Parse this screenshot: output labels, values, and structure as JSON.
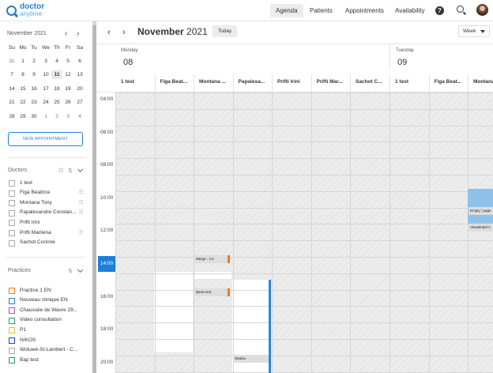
{
  "brand": {
    "line1": "doctor",
    "line2": "anytime"
  },
  "nav": {
    "agenda": "Agenda",
    "patients": "Patients",
    "appointments": "Appointments",
    "availability": "Availability",
    "help": "?"
  },
  "mini_calendar": {
    "title": "November 2021",
    "weekdays": [
      "Su",
      "Mo",
      "Tu",
      "We",
      "Th",
      "Fr",
      "Sa"
    ],
    "weeks": [
      [
        "31",
        "1",
        "2",
        "3",
        "4",
        "5",
        "6"
      ],
      [
        "7",
        "8",
        "9",
        "10",
        "11",
        "12",
        "13"
      ],
      [
        "14",
        "15",
        "16",
        "17",
        "18",
        "19",
        "20"
      ],
      [
        "21",
        "22",
        "23",
        "24",
        "25",
        "26",
        "27"
      ],
      [
        "28",
        "29",
        "30",
        "1",
        "2",
        "3",
        "4"
      ]
    ]
  },
  "new_appointment_label": "NEW APPOINTMENT",
  "doctors": {
    "title": "Doctors",
    "items": [
      "1 test",
      "Figa Beatrice",
      "Montana Tony",
      "Papalexandre Constan...",
      "Prifti Irini",
      "Prifti Marilena",
      "Sachot Corinne"
    ]
  },
  "practices": {
    "title": "Practices",
    "items": [
      {
        "name": "Practice 1 EN",
        "color": "#e87d1e"
      },
      {
        "name": "Nouveau clinique EN",
        "color": "#1e7fd6"
      },
      {
        "name": "Chaussée de Wavre 29...",
        "color": "#9b59b6"
      },
      {
        "name": "Video consultation",
        "color": "#2e9a5a"
      },
      {
        "name": "P1",
        "color": "#e8c41e"
      },
      {
        "name": "NIKOS",
        "color": "#1e3fd6"
      },
      {
        "name": "Woluwé-St-Lambert - C...",
        "color": "#aaaaaa"
      },
      {
        "name": "Bap test",
        "color": "#2e9a5a"
      }
    ]
  },
  "calendar": {
    "month": "November",
    "year": "2021",
    "today_label": "Today",
    "view": "Week",
    "days": [
      {
        "label": "Monday",
        "num": "08"
      },
      {
        "label": "Tuesday",
        "num": "09"
      }
    ],
    "resources_day1": [
      "1 test",
      "Figa Beat...",
      "Montana ...",
      "Papalexa...",
      "Prifti Irini",
      "Prifti Mar...",
      "Sachot C..."
    ],
    "resources_day2": [
      "1 test",
      "Figa Beat...",
      "Montana ..."
    ],
    "hours": [
      "04:00",
      "06:00",
      "08:00",
      "10:00",
      "12:00",
      "14:00",
      "16:00",
      "18:00",
      "20:00"
    ],
    "appointments": [
      "Merge - Co",
      "Back-end",
      "Statine",
      "Empty \\ page",
      "ViewModel C"
    ]
  }
}
